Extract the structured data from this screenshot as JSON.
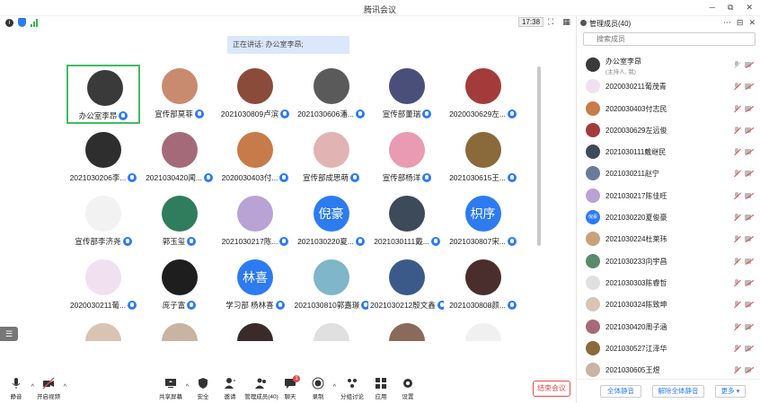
{
  "app": {
    "title": "腾讯会议",
    "clock": "17:38",
    "window_controls": [
      "─",
      "⧉",
      "✕"
    ]
  },
  "speaking_banner": "正在讲话: 办公室李昂;",
  "participants": [
    {
      "name": "办公室李昂",
      "color": "#3a3a3a",
      "active": true
    },
    {
      "name": "宣传部莫菲",
      "color": "#c98b6f"
    },
    {
      "name": "2021030809卢滨",
      "color": "#8a4b3b"
    },
    {
      "name": "2021030606潘...",
      "color": "#5a5a5a"
    },
    {
      "name": "宣传部董瑞",
      "color": "#4a4f7a"
    },
    {
      "name": "2020030629左...",
      "color": "#a33b3b"
    },
    {
      "name": "2021030206李...",
      "color": "#2e2e2e"
    },
    {
      "name": "2021030420闻...",
      "color": "#a56a7a"
    },
    {
      "name": "2020030403付...",
      "color": "#c77a4a"
    },
    {
      "name": "宣传部成思萌",
      "color": "#e2b3b3"
    },
    {
      "name": "宣传部杨洋",
      "color": "#e89bb3"
    },
    {
      "name": "2021030615王...",
      "color": "#8a6a3a"
    },
    {
      "name": "宣传部李济尧",
      "color": "#f2f2f2"
    },
    {
      "name": "郭玉玺",
      "color": "#2f7d5d"
    },
    {
      "name": "2021030217陈...",
      "color": "#b9a2d4"
    },
    {
      "name": "2021030220夏...",
      "color": "#2d7bf0",
      "initials": "倪豪"
    },
    {
      "name": "2021030111戴...",
      "color": "#3d4a5a"
    },
    {
      "name": "2021030807宋...",
      "color": "#2d7bf0",
      "initials": "枳序"
    },
    {
      "name": "2020030211葡...",
      "color": "#f0e0f0"
    },
    {
      "name": "庞子富",
      "color": "#1e1e1e"
    },
    {
      "name": "学习部 杨林喜",
      "color": "#2d7bf0",
      "initials": "林喜"
    },
    {
      "name": "2021030810郭嘉璟",
      "color": "#7fb6c9"
    },
    {
      "name": "2021030212殷文鑫",
      "color": "#3b5a8a"
    },
    {
      "name": "2021030808颜...",
      "color": "#4a2e2e"
    },
    {
      "name": "",
      "color": "#d9c3b3"
    },
    {
      "name": "",
      "color": "#c9b3a3"
    },
    {
      "name": "",
      "color": "#3a2a2a"
    },
    {
      "name": "",
      "color": "#e0e0e0"
    },
    {
      "name": "",
      "color": "#8a6a5a"
    },
    {
      "name": "",
      "color": "#f0f0f0"
    }
  ],
  "toolbar": {
    "mute": "静音",
    "video": "开启视频",
    "share": "共享屏幕",
    "security": "安全",
    "invite": "邀请",
    "manage": "管理成员(40)",
    "chat": "聊天",
    "chat_badge": "1",
    "record": "录制",
    "breakout": "分组讨论",
    "apps": "应用",
    "settings": "设置",
    "end": "结束会议"
  },
  "panel": {
    "title": "管理成员(40)",
    "search_placeholder": "搜索成员",
    "members": [
      {
        "name": "办公室李昂",
        "sub": "(主持人, 我)",
        "color": "#3a3a3a",
        "host": true
      },
      {
        "name": "2020030211葡茂青",
        "color": "#f0e0f0"
      },
      {
        "name": "2020030403付志民",
        "color": "#c77a4a"
      },
      {
        "name": "2020030629左远俊",
        "color": "#a33b3b"
      },
      {
        "name": "2021030111戴继民",
        "color": "#3d4a5a"
      },
      {
        "name": "2021030211赵宁",
        "color": "#6a7a9a"
      },
      {
        "name": "2021030217陈佳旺",
        "color": "#b9a2d4"
      },
      {
        "name": "2021030220夏俊豪",
        "color": "#2d7bf0",
        "initials": "倪豪"
      },
      {
        "name": "2021030224杜莱玮",
        "color": "#c9a27a"
      },
      {
        "name": "2021030233向宇昌",
        "color": "#5a8a6a"
      },
      {
        "name": "2021030303陈睿哲",
        "color": "#e0e0e0"
      },
      {
        "name": "2021030324陈致坤",
        "color": "#d9c3b3"
      },
      {
        "name": "2021030420周子涵",
        "color": "#a56a7a"
      },
      {
        "name": "2021030527江泽华",
        "color": "#8a6a3a"
      },
      {
        "name": "2021030605王煜",
        "color": "#c9b3a3"
      }
    ],
    "mute_all": "全体静音",
    "unmute_all": "解除全体静音",
    "more": "更多 ▾"
  }
}
